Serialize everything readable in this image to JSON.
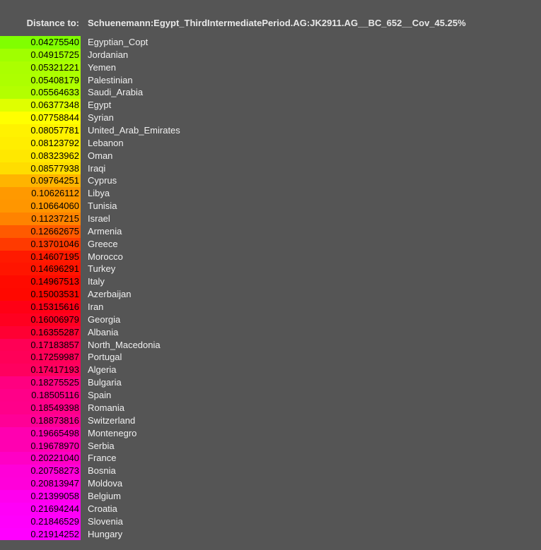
{
  "header": {
    "label": "Distance to:",
    "target": "Schuenemann:Egypt_ThirdIntermediatePeriod.AG:JK2911.AG__BC_652__Cov_45.25%"
  },
  "rows": [
    {
      "value": "0.04275540",
      "population": "Egyptian_Copt",
      "color": "#80ff00"
    },
    {
      "value": "0.04915725",
      "population": "Jordanian",
      "color": "#a0ff00"
    },
    {
      "value": "0.05321221",
      "population": "Yemen",
      "color": "#abff00"
    },
    {
      "value": "0.05408179",
      "population": "Palestinian",
      "color": "#adff00"
    },
    {
      "value": "0.05564633",
      "population": "Saudi_Arabia",
      "color": "#b3ff00"
    },
    {
      "value": "0.06377348",
      "population": "Egypt",
      "color": "#dfff00"
    },
    {
      "value": "0.07758844",
      "population": "Syrian",
      "color": "#ffff00"
    },
    {
      "value": "0.08057781",
      "population": "United_Arab_Emirates",
      "color": "#fff200"
    },
    {
      "value": "0.08123792",
      "population": "Lebanon",
      "color": "#ffee00"
    },
    {
      "value": "0.08323962",
      "population": "Oman",
      "color": "#ffe800"
    },
    {
      "value": "0.08577938",
      "population": "Iraqi",
      "color": "#ffdd00"
    },
    {
      "value": "0.09764251",
      "population": "Cyprus",
      "color": "#ffb400"
    },
    {
      "value": "0.10626112",
      "population": "Libya",
      "color": "#ff9900"
    },
    {
      "value": "0.10664060",
      "population": "Tunisia",
      "color": "#ff9600"
    },
    {
      "value": "0.11237215",
      "population": "Israel",
      "color": "#ff8300"
    },
    {
      "value": "0.12662675",
      "population": "Armenia",
      "color": "#ff5a00"
    },
    {
      "value": "0.13701046",
      "population": "Greece",
      "color": "#ff3a00"
    },
    {
      "value": "0.14607195",
      "population": "Morocco",
      "color": "#ff1a00"
    },
    {
      "value": "0.14696291",
      "population": "Turkey",
      "color": "#ff1500"
    },
    {
      "value": "0.14967513",
      "population": "Italy",
      "color": "#ff0a00"
    },
    {
      "value": "0.15003531",
      "population": "Azerbaijan",
      "color": "#ff0800"
    },
    {
      "value": "0.15315616",
      "population": "Iran",
      "color": "#ff0015"
    },
    {
      "value": "0.16006979",
      "population": "Georgia",
      "color": "#ff0020"
    },
    {
      "value": "0.16355287",
      "population": "Albania",
      "color": "#ff0033"
    },
    {
      "value": "0.17183857",
      "population": "North_Macedonia",
      "color": "#ff0055"
    },
    {
      "value": "0.17259987",
      "population": "Portugal",
      "color": "#ff0058"
    },
    {
      "value": "0.17417193",
      "population": "Algeria",
      "color": "#ff005f"
    },
    {
      "value": "0.18275525",
      "population": "Bulgaria",
      "color": "#ff0080"
    },
    {
      "value": "0.18505116",
      "population": "Spain",
      "color": "#ff0088"
    },
    {
      "value": "0.18549398",
      "population": "Romania",
      "color": "#ff008a"
    },
    {
      "value": "0.18873816",
      "population": "Switzerland",
      "color": "#ff0096"
    },
    {
      "value": "0.19665498",
      "population": "Montenegro",
      "color": "#ff00b0"
    },
    {
      "value": "0.19678970",
      "population": "Serbia",
      "color": "#ff00b1"
    },
    {
      "value": "0.20221040",
      "population": "France",
      "color": "#ff00c5"
    },
    {
      "value": "0.20758273",
      "population": "Bosnia",
      "color": "#ff00d8"
    },
    {
      "value": "0.20813947",
      "population": "Moldova",
      "color": "#ff00da"
    },
    {
      "value": "0.21399058",
      "population": "Belgium",
      "color": "#ff00ee"
    },
    {
      "value": "0.21694244",
      "population": "Croatia",
      "color": "#ff00f7"
    },
    {
      "value": "0.21846529",
      "population": "Slovenia",
      "color": "#ff00fb"
    },
    {
      "value": "0.21914252",
      "population": "Hungary",
      "color": "#ff00ff"
    }
  ]
}
